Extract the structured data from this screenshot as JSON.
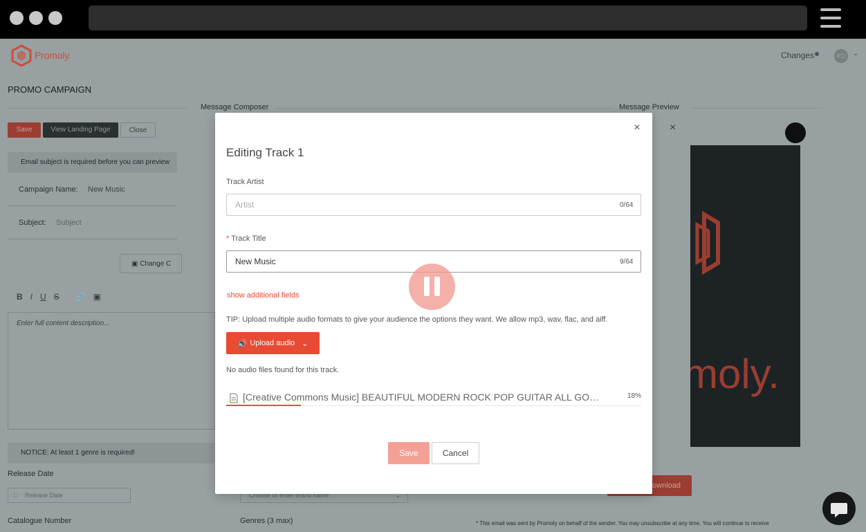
{
  "window": {
    "traffic_lights": [
      "close",
      "minimize",
      "maximize"
    ]
  },
  "app": {
    "brand": "Promoly.",
    "changes_label": "Changes",
    "avatar_initials": "RD",
    "page_title": "PROMO CAMPAIGN",
    "composer_label": "Message Composer",
    "preview_label": "Message Preview",
    "toolbar": {
      "save_label": "Save",
      "view_landing_label": "View Landing Page",
      "close_label": "Close"
    },
    "subject_notice": "Email subject is required before you can preview",
    "campaign_name_label": "Campaign Name:",
    "campaign_name_value": "New Music",
    "subject_label": "Subject:",
    "subject_placeholder": "Subject",
    "change_cover_label": "Change C",
    "editor_icons": [
      "B",
      "I",
      "U",
      "S"
    ],
    "description_placeholder": "Enter full content description...",
    "genre_notice": "NOTICE: At least 1 genre is required!",
    "release_date_label": "Release Date",
    "release_date_placeholder": "Release Date",
    "brand_placeholder": "Choose or enter brand name",
    "catalogue_label": "Catalogue Number",
    "genres_label": "Genres (3 max)",
    "download_label": "Download",
    "preview_brand_fragment": "moly.",
    "footer_note": "* This email was sent by Promoly on behalf of the sender. You may unsubscribe at any time. You will continue to receive"
  },
  "modal": {
    "title": "Editing Track 1",
    "artist_label": "Track Artist",
    "artist_placeholder": "Artist",
    "artist_value": "",
    "artist_counter": "0/64",
    "title_label": "Track Title",
    "title_value": "New Music",
    "title_counter": "9/64",
    "show_additional": "show additional fields",
    "tip": "TIP: Upload multiple audio formats to give your audience the options they want. We allow mp3, wav, flac, and aiff.",
    "upload_label": "Upload audio",
    "no_files": "No audio files found for this track.",
    "upload_file": {
      "name": "[Creative Commons Music] BEAUTIFUL MODERN ROCK POP GUITAR ALL GOOD",
      "percent_label": "18%",
      "progress": 0.18
    },
    "save_label": "Save",
    "cancel_label": "Cancel"
  },
  "colors": {
    "accent": "#e84a34",
    "save_disabled": "#f3a195"
  }
}
